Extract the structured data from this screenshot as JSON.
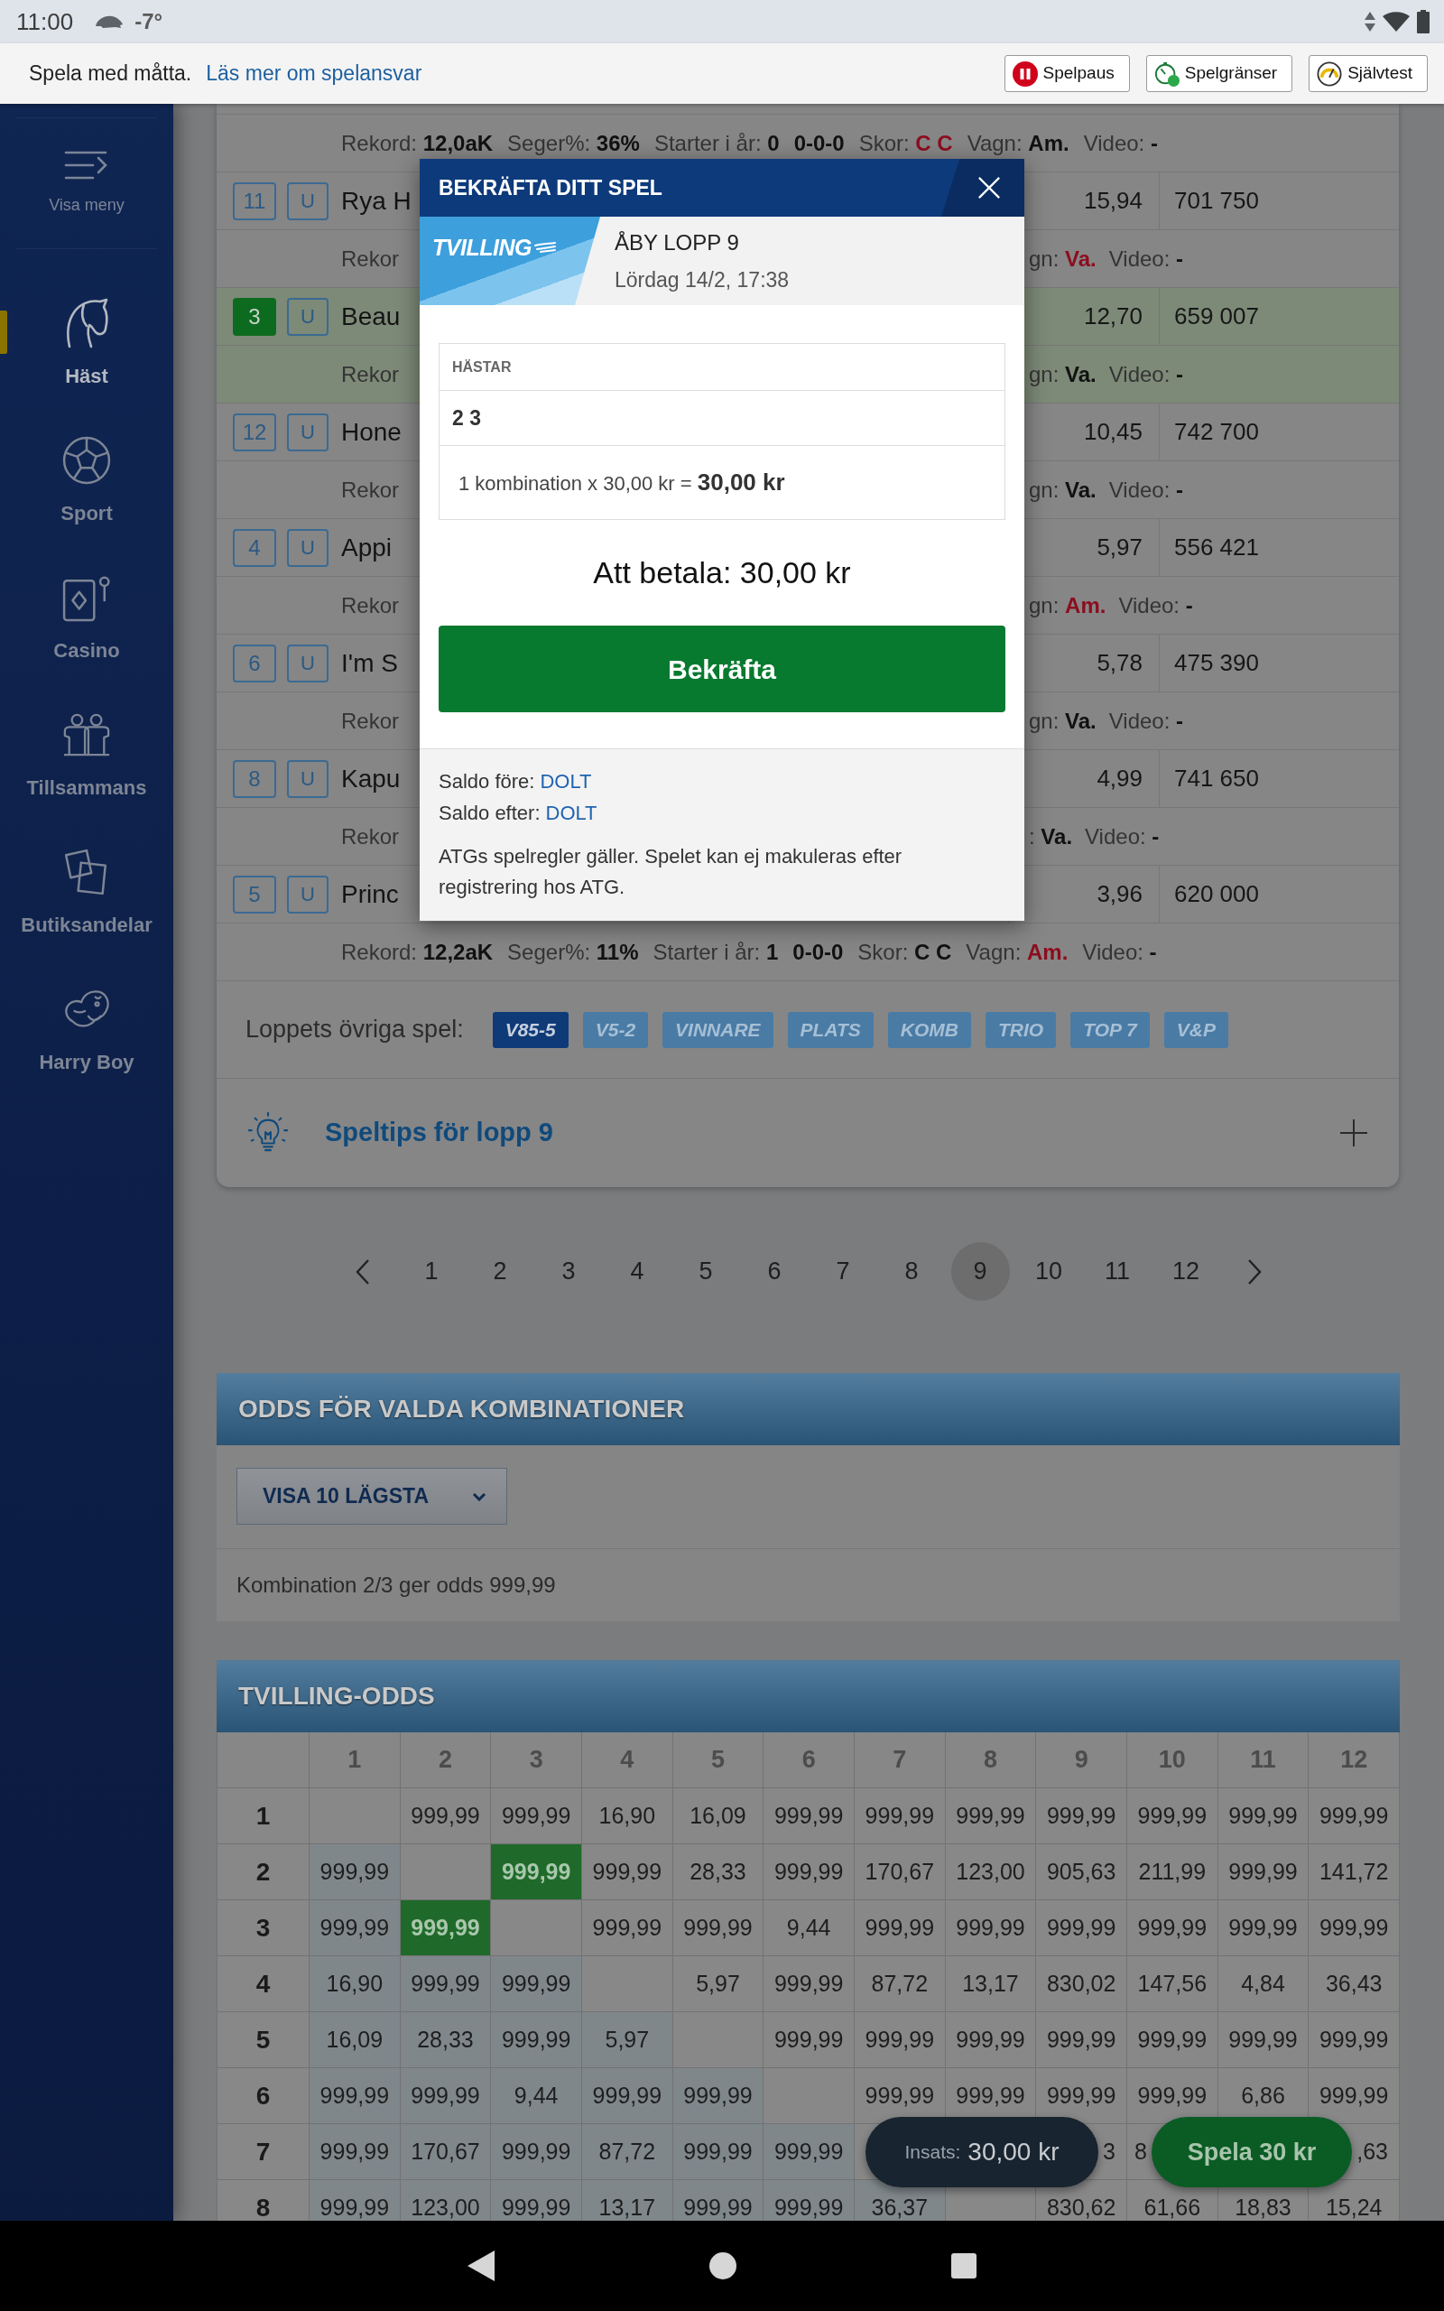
{
  "status_bar": {
    "time": "11:00",
    "temperature": "-7°"
  },
  "responsible_gaming_bar": {
    "text": "Spela med måtta.",
    "link": "Läs mer om spelansvar",
    "buttons": [
      "Spelpaus",
      "Spelgränser",
      "Självtest"
    ]
  },
  "sidebar": {
    "menu_label": "Visa meny",
    "items": [
      {
        "label": "Häst",
        "selected": true
      },
      {
        "label": "Sport",
        "selected": false
      },
      {
        "label": "Casino",
        "selected": false
      },
      {
        "label": "Tillsammans",
        "selected": false
      },
      {
        "label": "Butiksandelar",
        "selected": false
      },
      {
        "label": "Harry Boy",
        "selected": false
      }
    ]
  },
  "race_card": {
    "rows": [
      {
        "record": [
          {
            "label": "Rekord:",
            "value": "12,0aK"
          },
          {
            "label": "Seger%:",
            "value": "36%"
          },
          {
            "label": "Starter i år:",
            "value": "0"
          },
          {
            "value": "0-0-0"
          },
          {
            "label": "Skor:",
            "value": "C C",
            "highlight": true
          },
          {
            "label": "Vagn:",
            "value": "Am.",
            "highlight": false
          },
          {
            "label": "Video:",
            "value": "-"
          }
        ]
      },
      {
        "number": "11",
        "selected": false,
        "status": "U",
        "name": "Rya H",
        "odds": "15,94",
        "prize": "701 750",
        "record_start": "Rekor",
        "record": [
          {
            "label": "gn:",
            "value": "Va.",
            "highlight": true
          },
          {
            "label": "Video:",
            "value": "-"
          }
        ]
      },
      {
        "number": "3",
        "selected": true,
        "status": "U",
        "name": "Beau",
        "odds": "12,70",
        "prize": "659 007",
        "record_start": "Rekor",
        "record": [
          {
            "label": "gn:",
            "value": "Va.",
            "highlight": false
          },
          {
            "label": "Video:",
            "value": "-"
          }
        ]
      },
      {
        "number": "12",
        "selected": false,
        "status": "U",
        "name": "Hone",
        "odds": "10,45",
        "prize": "742 700",
        "record_start": "Rekor",
        "record": [
          {
            "label": "gn:",
            "value": "Va.",
            "highlight": false
          },
          {
            "label": "Video:",
            "value": "-"
          }
        ]
      },
      {
        "number": "4",
        "selected": false,
        "status": "U",
        "name": "Appi",
        "odds": "5,97",
        "prize": "556 421",
        "record_start": "Rekor",
        "record": [
          {
            "label": "gn:",
            "value": "Am.",
            "highlight": true
          },
          {
            "label": "Video:",
            "value": "-"
          }
        ]
      },
      {
        "number": "6",
        "selected": false,
        "status": "U",
        "name": "I'm S",
        "odds": "5,78",
        "prize": "475 390",
        "record_start": "Rekor",
        "record": [
          {
            "label": "gn:",
            "value": "Va.",
            "highlight": false
          },
          {
            "label": "Video:",
            "value": "-"
          }
        ]
      },
      {
        "number": "8",
        "selected": false,
        "status": "U",
        "name": "Kapu",
        "odds": "4,99",
        "prize": "741 650",
        "record_start": "Rekor",
        "record": [
          {
            "label": ":",
            "value": "Va.",
            "highlight": false
          },
          {
            "label": "Video:",
            "value": "-"
          }
        ]
      },
      {
        "number": "5",
        "selected": false,
        "status": "U",
        "name": "Princ",
        "odds": "3,96",
        "prize": "620 000",
        "record": [
          {
            "label": "Rekord:",
            "value": "12,2aK"
          },
          {
            "label": "Seger%:",
            "value": "11%"
          },
          {
            "label": "Starter i år:",
            "value": "1"
          },
          {
            "value": "0-0-0"
          },
          {
            "label": "Skor:",
            "value": "C C",
            "highlight": false
          },
          {
            "label": "Vagn:",
            "value": "Am.",
            "highlight": true
          },
          {
            "label": "Video:",
            "value": "-"
          }
        ]
      }
    ],
    "other_games": {
      "label": "Loppets övriga spel:",
      "games": [
        {
          "label": "V85-5",
          "selected": true
        },
        {
          "label": "V5-2",
          "selected": false
        },
        {
          "label": "VINNARE",
          "selected": false
        },
        {
          "label": "PLATS",
          "selected": false
        },
        {
          "label": "KOMB",
          "selected": false
        },
        {
          "label": "TRIO",
          "selected": false
        },
        {
          "label": "TOP 7",
          "selected": false
        },
        {
          "label": "V&P",
          "selected": false
        }
      ]
    },
    "tips": {
      "title": "Speltips för lopp 9",
      "expanded": false
    }
  },
  "pagination": {
    "pages": [
      {
        "label": "1",
        "selected": false
      },
      {
        "label": "2",
        "selected": false
      },
      {
        "label": "3",
        "selected": false
      },
      {
        "label": "4",
        "selected": false
      },
      {
        "label": "5",
        "selected": false
      },
      {
        "label": "6",
        "selected": false
      },
      {
        "label": "7",
        "selected": false
      },
      {
        "label": "8",
        "selected": false
      },
      {
        "label": "9",
        "selected": true
      },
      {
        "label": "10",
        "selected": false
      },
      {
        "label": "11",
        "selected": false
      },
      {
        "label": "12",
        "selected": false
      }
    ]
  },
  "odds_for_combinations": {
    "title": "ODDS FÖR VALDA KOMBINATIONER",
    "dropdown": "VISA 10 LÄGSTA",
    "result": "Kombination 2/3 ger odds 999,99"
  },
  "twin_odds": {
    "title": "TVILLING-ODDS",
    "columns": [
      "1",
      "2",
      "3",
      "4",
      "5",
      "6",
      "7",
      "8",
      "9",
      "10",
      "11",
      "12"
    ],
    "rows": [
      {
        "label": "1",
        "cells": [
          null,
          {
            "text": "999,99",
            "selected": false
          },
          {
            "text": "999,99",
            "selected": false
          },
          {
            "text": "16,90",
            "selected": false
          },
          {
            "text": "16,09",
            "selected": false
          },
          {
            "text": "999,99",
            "selected": false
          },
          {
            "text": "999,99",
            "selected": false
          },
          {
            "text": "999,99",
            "selected": false
          },
          {
            "text": "999,99",
            "selected": false
          },
          {
            "text": "999,99",
            "selected": false
          },
          {
            "text": "999,99",
            "selected": false
          },
          {
            "text": "999,99",
            "selected": false
          }
        ]
      },
      {
        "label": "2",
        "cells": [
          {
            "text": "999,99",
            "selected": false
          },
          null,
          {
            "text": "999,99",
            "selected": true
          },
          {
            "text": "999,99",
            "selected": false
          },
          {
            "text": "28,33",
            "selected": false
          },
          {
            "text": "999,99",
            "selected": false
          },
          {
            "text": "170,67",
            "selected": false
          },
          {
            "text": "123,00",
            "selected": false
          },
          {
            "text": "905,63",
            "selected": false
          },
          {
            "text": "211,99",
            "selected": false
          },
          {
            "text": "999,99",
            "selected": false
          },
          {
            "text": "141,72",
            "selected": false
          }
        ]
      },
      {
        "label": "3",
        "cells": [
          {
            "text": "999,99",
            "selected": false
          },
          {
            "text": "999,99",
            "selected": true
          },
          null,
          {
            "text": "999,99",
            "selected": false
          },
          {
            "text": "999,99",
            "selected": false
          },
          {
            "text": "9,44",
            "selected": false
          },
          {
            "text": "999,99",
            "selected": false
          },
          {
            "text": "999,99",
            "selected": false
          },
          {
            "text": "999,99",
            "selected": false
          },
          {
            "text": "999,99",
            "selected": false
          },
          {
            "text": "999,99",
            "selected": false
          },
          {
            "text": "999,99",
            "selected": false
          }
        ]
      },
      {
        "label": "4",
        "cells": [
          {
            "text": "16,90",
            "selected": false
          },
          {
            "text": "999,99",
            "selected": false
          },
          {
            "text": "999,99",
            "selected": false
          },
          null,
          {
            "text": "5,97",
            "selected": false
          },
          {
            "text": "999,99",
            "selected": false
          },
          {
            "text": "87,72",
            "selected": false
          },
          {
            "text": "13,17",
            "selected": false
          },
          {
            "text": "830,02",
            "selected": false
          },
          {
            "text": "147,56",
            "selected": false
          },
          {
            "text": "4,84",
            "selected": false
          },
          {
            "text": "36,43",
            "selected": false
          }
        ]
      },
      {
        "label": "5",
        "cells": [
          {
            "text": "16,09",
            "selected": false
          },
          {
            "text": "28,33",
            "selected": false
          },
          {
            "text": "999,99",
            "selected": false
          },
          {
            "text": "5,97",
            "selected": false
          },
          null,
          {
            "text": "999,99",
            "selected": false
          },
          {
            "text": "999,99",
            "selected": false
          },
          {
            "text": "999,99",
            "selected": false
          },
          {
            "text": "999,99",
            "selected": false
          },
          {
            "text": "999,99",
            "selected": false
          },
          {
            "text": "999,99",
            "selected": false
          },
          {
            "text": "999,99",
            "selected": false
          }
        ]
      },
      {
        "label": "6",
        "cells": [
          {
            "text": "999,99",
            "selected": false
          },
          {
            "text": "999,99",
            "selected": false
          },
          {
            "text": "9,44",
            "selected": false
          },
          {
            "text": "999,99",
            "selected": false
          },
          {
            "text": "999,99",
            "selected": false
          },
          null,
          {
            "text": "999,99",
            "selected": false
          },
          {
            "text": "999,99",
            "selected": false
          },
          {
            "text": "999,99",
            "selected": false
          },
          {
            "text": "999,99",
            "selected": false
          },
          {
            "text": "6,86",
            "selected": false
          },
          {
            "text": "999,99",
            "selected": false
          }
        ]
      },
      {
        "label": "7",
        "cells": [
          {
            "text": "999,99",
            "selected": false
          },
          {
            "text": "170,67",
            "selected": false
          },
          {
            "text": "999,99",
            "selected": false
          },
          {
            "text": "87,72",
            "selected": false
          },
          {
            "text": "999,99",
            "selected": false
          },
          {
            "text": "999,99",
            "selected": false
          },
          null,
          null,
          {
            "text": "3",
            "selected": false,
            "start_hidden": true
          },
          {
            "text": "8",
            "selected": false,
            "end_hidden": true
          },
          null,
          {
            "text": ",63",
            "selected": false,
            "start_hidden": true
          }
        ]
      },
      {
        "label": "8",
        "cells": [
          {
            "text": "999,99",
            "selected": false
          },
          {
            "text": "123,00",
            "selected": false
          },
          {
            "text": "999,99",
            "selected": false
          },
          {
            "text": "13,17",
            "selected": false
          },
          {
            "text": "999,99",
            "selected": false
          },
          {
            "text": "999,99",
            "selected": false
          },
          {
            "text": "36,37",
            "selected": false
          },
          null,
          {
            "text": "830,62",
            "selected": false
          },
          {
            "text": "61,66",
            "selected": false
          },
          {
            "text": "18,83",
            "selected": false
          },
          {
            "text": "15,24",
            "selected": false
          }
        ]
      }
    ]
  },
  "floating_bar": {
    "stake_label": "Insats:",
    "stake": "30,00 kr",
    "play_button": "Spela 30 kr"
  },
  "confirm_dialog": {
    "title": "BEKRÄFTA DITT SPEL",
    "game_logo": "TVILLING",
    "race": "ÅBY LOPP 9",
    "date": "Lördag 14/2, 17:38",
    "horses_header": "HÄSTAR",
    "horses": "2 3",
    "calculation": "1 kombination x 30,00 kr = **30,00 kr**",
    "to_pay": "Att betala: 30,00 kr",
    "confirm_button": "Bekräfta",
    "balance_before": {
      "label": "Saldo före:",
      "value": "DOLT"
    },
    "balance_after": {
      "label": "Saldo efter:",
      "value": "DOLT"
    },
    "terms": "ATGs spelregler gäller. Spelet kan ej makuleras efter registrering hos ATG."
  }
}
